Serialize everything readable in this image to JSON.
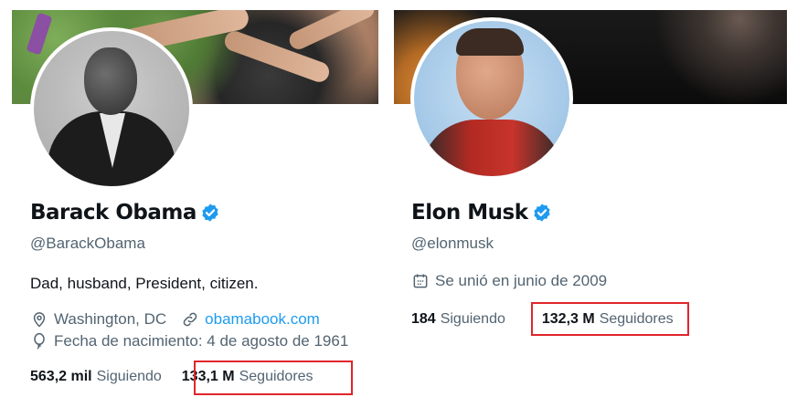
{
  "profiles": [
    {
      "name": "Barack Obama",
      "handle": "@BarackObama",
      "bio": "Dad, husband, President, citizen.",
      "location": "Washington, DC",
      "website": "obamabook.com",
      "birthday": "Fecha de nacimiento: 4 de agosto de 1961",
      "following_count": "563,2 mil",
      "following_label": "Siguiendo",
      "followers_count": "133,1 M",
      "followers_label": "Seguidores",
      "verified": true
    },
    {
      "name": "Elon Musk",
      "handle": "@elonmusk",
      "joined": "Se unió en junio de 2009",
      "following_count": "184",
      "following_label": "Siguiendo",
      "followers_count": "132,3 M",
      "followers_label": "Seguidores",
      "verified": true
    }
  ],
  "colors": {
    "text_primary": "#0f1419",
    "text_secondary": "#536471",
    "link": "#1d9bf0",
    "verified_badge": "#1d9bf0",
    "highlight_box": "#e0252b"
  },
  "icons": [
    "verified-badge-icon",
    "location-pin-icon",
    "link-icon",
    "birthday-balloon-icon",
    "calendar-icon"
  ]
}
